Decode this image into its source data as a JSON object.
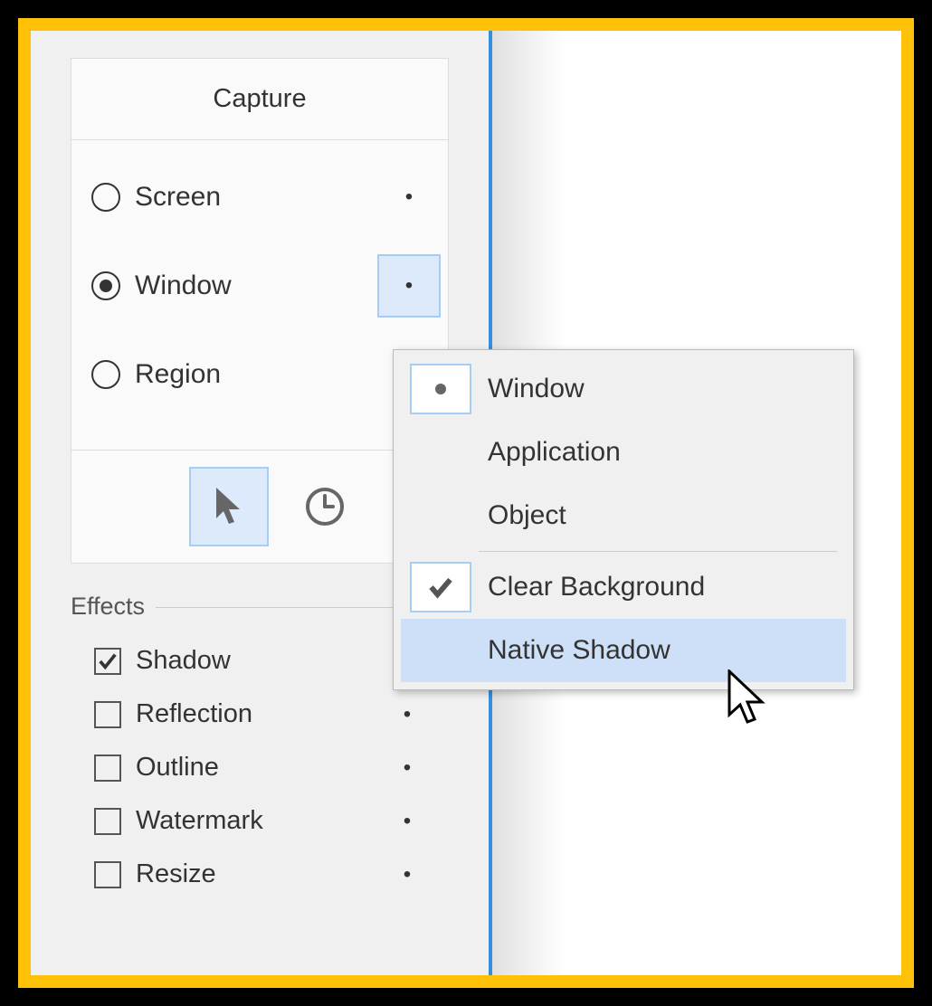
{
  "panel": {
    "title": "Capture",
    "radios": [
      {
        "label": "Screen",
        "selected": false,
        "highlighted": false
      },
      {
        "label": "Window",
        "selected": true,
        "highlighted": true
      },
      {
        "label": "Region",
        "selected": false,
        "highlighted": false
      }
    ]
  },
  "effects": {
    "title": "Effects",
    "items": [
      {
        "label": "Shadow",
        "checked": true,
        "has_dot": false
      },
      {
        "label": "Reflection",
        "checked": false,
        "has_dot": true
      },
      {
        "label": "Outline",
        "checked": false,
        "has_dot": true
      },
      {
        "label": "Watermark",
        "checked": false,
        "has_dot": true
      },
      {
        "label": "Resize",
        "checked": false,
        "has_dot": true
      }
    ]
  },
  "popup": {
    "groups": [
      {
        "items": [
          {
            "label": "Window",
            "marker": "dot",
            "boxed": true,
            "highlighted": false
          },
          {
            "label": "Application",
            "marker": "none",
            "boxed": false,
            "highlighted": false
          },
          {
            "label": "Object",
            "marker": "none",
            "boxed": false,
            "highlighted": false
          }
        ]
      },
      {
        "items": [
          {
            "label": "Clear Background",
            "marker": "check",
            "boxed": true,
            "highlighted": false
          },
          {
            "label": "Native Shadow",
            "marker": "none",
            "boxed": false,
            "highlighted": true
          }
        ]
      }
    ]
  }
}
